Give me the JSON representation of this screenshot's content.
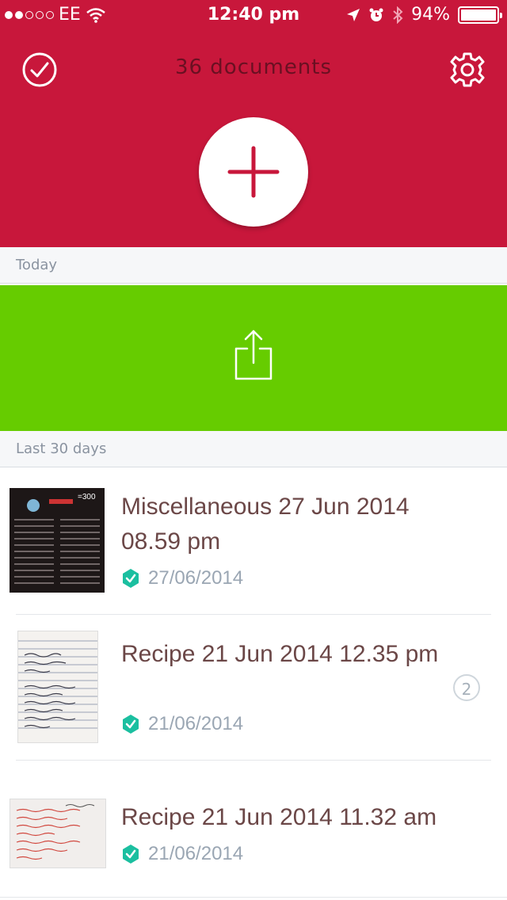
{
  "status_bar": {
    "carrier": "EE",
    "time": "12:40 pm",
    "battery": "94%"
  },
  "header": {
    "title": "36 documents"
  },
  "sections": {
    "today": "Today",
    "last30": "Last 30 days"
  },
  "documents": [
    {
      "title": "Miscellaneous 27 Jun 2014 08.59 pm",
      "date": "27/06/2014"
    },
    {
      "title": "Recipe 21 Jun 2014 12.35 pm",
      "date": "21/06/2014",
      "count": "2"
    },
    {
      "title": "Recipe 21 Jun 2014 11.32 am",
      "date": "21/06/2014"
    }
  ],
  "colors": {
    "header": "#c8173b",
    "share": "#66cc00",
    "verified": "#1bbfa0"
  },
  "icons": [
    "check-circle-icon",
    "gear-icon",
    "plus-icon",
    "share-icon",
    "verified-icon",
    "wifi-icon",
    "location-icon",
    "alarm-icon",
    "bluetooth-icon",
    "battery-icon"
  ]
}
